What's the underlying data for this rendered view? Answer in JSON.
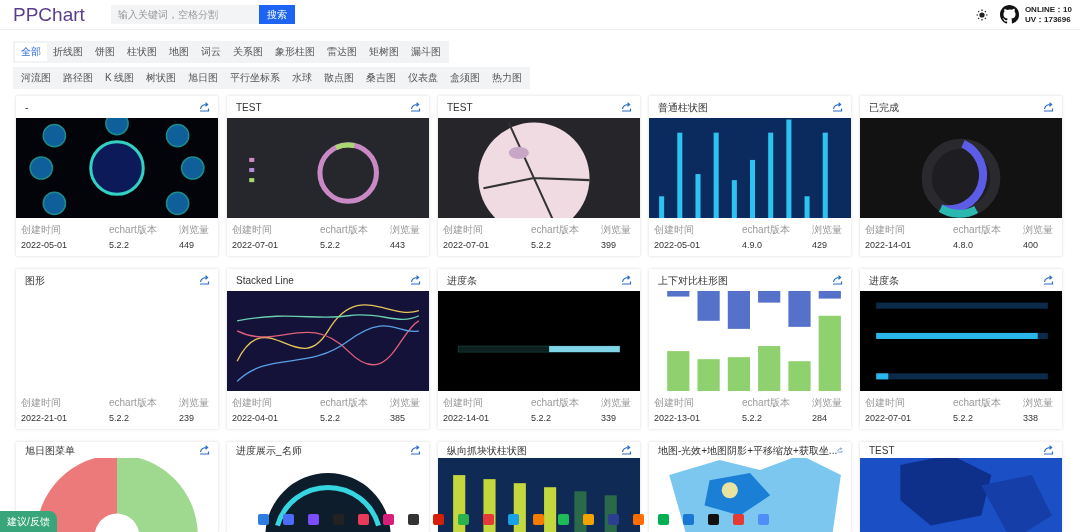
{
  "header": {
    "logo": "PPChart",
    "search": {
      "placeholder": "输入关键词，空格分割"
    },
    "search_button": "搜索",
    "online": "ONLINE：10",
    "uv": "UV：173696"
  },
  "tab_rows": [
    [
      {
        "label": "全部",
        "selected": true
      },
      {
        "label": "折线图",
        "selected": false
      },
      {
        "label": "饼图",
        "selected": false
      },
      {
        "label": "柱状图",
        "selected": false
      },
      {
        "label": "地图",
        "selected": false
      },
      {
        "label": "词云",
        "selected": false
      },
      {
        "label": "关系图",
        "selected": false
      },
      {
        "label": "象形柱图",
        "selected": false
      },
      {
        "label": "雷达图",
        "selected": false
      },
      {
        "label": "矩树图",
        "selected": false
      },
      {
        "label": "漏斗图",
        "selected": false
      }
    ],
    [
      {
        "label": "河流图",
        "selected": false
      },
      {
        "label": "路径图",
        "selected": false
      },
      {
        "label": "K 线图",
        "selected": false
      },
      {
        "label": "树状图",
        "selected": false
      },
      {
        "label": "旭日图",
        "selected": false
      },
      {
        "label": "平行坐标系",
        "selected": false
      },
      {
        "label": "水球",
        "selected": false
      },
      {
        "label": "散点图",
        "selected": false
      },
      {
        "label": "桑吉图",
        "selected": false
      },
      {
        "label": "仪表盘",
        "selected": false
      },
      {
        "label": "盒须图",
        "selected": false
      },
      {
        "label": "热力图",
        "selected": false
      }
    ]
  ],
  "cards": [
    {
      "title": "-",
      "stats": [
        {
          "label": "创建时间",
          "value": "2022-05-01"
        },
        {
          "label": "echart版本",
          "value": "5.2.2"
        },
        {
          "label": "浏览量",
          "value": "449"
        }
      ]
    },
    {
      "title": "TEST",
      "stats": [
        {
          "label": "创建时间",
          "value": "2022-07-01"
        },
        {
          "label": "echart版本",
          "value": "5.2.2"
        },
        {
          "label": "浏览量",
          "value": "443"
        }
      ]
    },
    {
      "title": "TEST",
      "stats": [
        {
          "label": "创建时间",
          "value": "2022-07-01"
        },
        {
          "label": "echart版本",
          "value": "5.2.2"
        },
        {
          "label": "浏览量",
          "value": "399"
        }
      ]
    },
    {
      "title": "普通柱状图",
      "stats": [
        {
          "label": "创建时间",
          "value": "2022-05-01"
        },
        {
          "label": "echart版本",
          "value": "4.9.0"
        },
        {
          "label": "浏览量",
          "value": "429"
        }
      ]
    },
    {
      "title": "已完成",
      "stats": [
        {
          "label": "创建时间",
          "value": "2022-14-01"
        },
        {
          "label": "echart版本",
          "value": "4.8.0"
        },
        {
          "label": "浏览量",
          "value": "400"
        }
      ]
    },
    {
      "title": "图形",
      "stats": [
        {
          "label": "创建时间",
          "value": "2022-21-01"
        },
        {
          "label": "echart版本",
          "value": "5.2.2"
        },
        {
          "label": "浏览量",
          "value": "239"
        }
      ]
    },
    {
      "title": "Stacked Line",
      "stats": [
        {
          "label": "创建时间",
          "value": "2022-04-01"
        },
        {
          "label": "echart版本",
          "value": "5.2.2"
        },
        {
          "label": "浏览量",
          "value": "385"
        }
      ]
    },
    {
      "title": "进度条",
      "stats": [
        {
          "label": "创建时间",
          "value": "2022-14-01"
        },
        {
          "label": "echart版本",
          "value": "5.2.2"
        },
        {
          "label": "浏览量",
          "value": "339"
        }
      ]
    },
    {
      "title": "上下对比柱形图",
      "stats": [
        {
          "label": "创建时间",
          "value": "2022-13-01"
        },
        {
          "label": "echart版本",
          "value": "5.2.2"
        },
        {
          "label": "浏览量",
          "value": "284"
        }
      ]
    },
    {
      "title": "进度条",
      "stats": [
        {
          "label": "创建时间",
          "value": "2022-07-01"
        },
        {
          "label": "echart版本",
          "value": "5.2.2"
        },
        {
          "label": "浏览量",
          "value": "338"
        }
      ]
    },
    {
      "title": "旭日图菜单"
    },
    {
      "title": "进度展示_名师"
    },
    {
      "title": "纵向抓块状柱状图"
    },
    {
      "title": "地图-光效+地图阴影+平移缩放+获取坐..."
    },
    {
      "title": "TEST"
    }
  ],
  "dock_icons": [
    {
      "color": "#2f7de1"
    },
    {
      "color": "#4a6cf7"
    },
    {
      "color": "#7c4dff"
    },
    {
      "color": "#222222"
    },
    {
      "color": "#e83b5c"
    },
    {
      "color": "#d81e7a"
    },
    {
      "color": "#333333"
    },
    {
      "color": "#d81e06"
    },
    {
      "color": "#2bb24c"
    },
    {
      "color": "#e53935"
    },
    {
      "color": "#1aa0e6"
    },
    {
      "color": "#f57c00"
    },
    {
      "color": "#1ebc59"
    },
    {
      "color": "#f4a300"
    },
    {
      "color": "#2c3e8f"
    },
    {
      "color": "#ff6d00"
    },
    {
      "color": "#00b050"
    },
    {
      "color": "#1976d2"
    },
    {
      "color": "#111111"
    },
    {
      "color": "#e53935"
    },
    {
      "color": "#4f8ef7"
    }
  ],
  "feedback_button": "建议/反馈"
}
